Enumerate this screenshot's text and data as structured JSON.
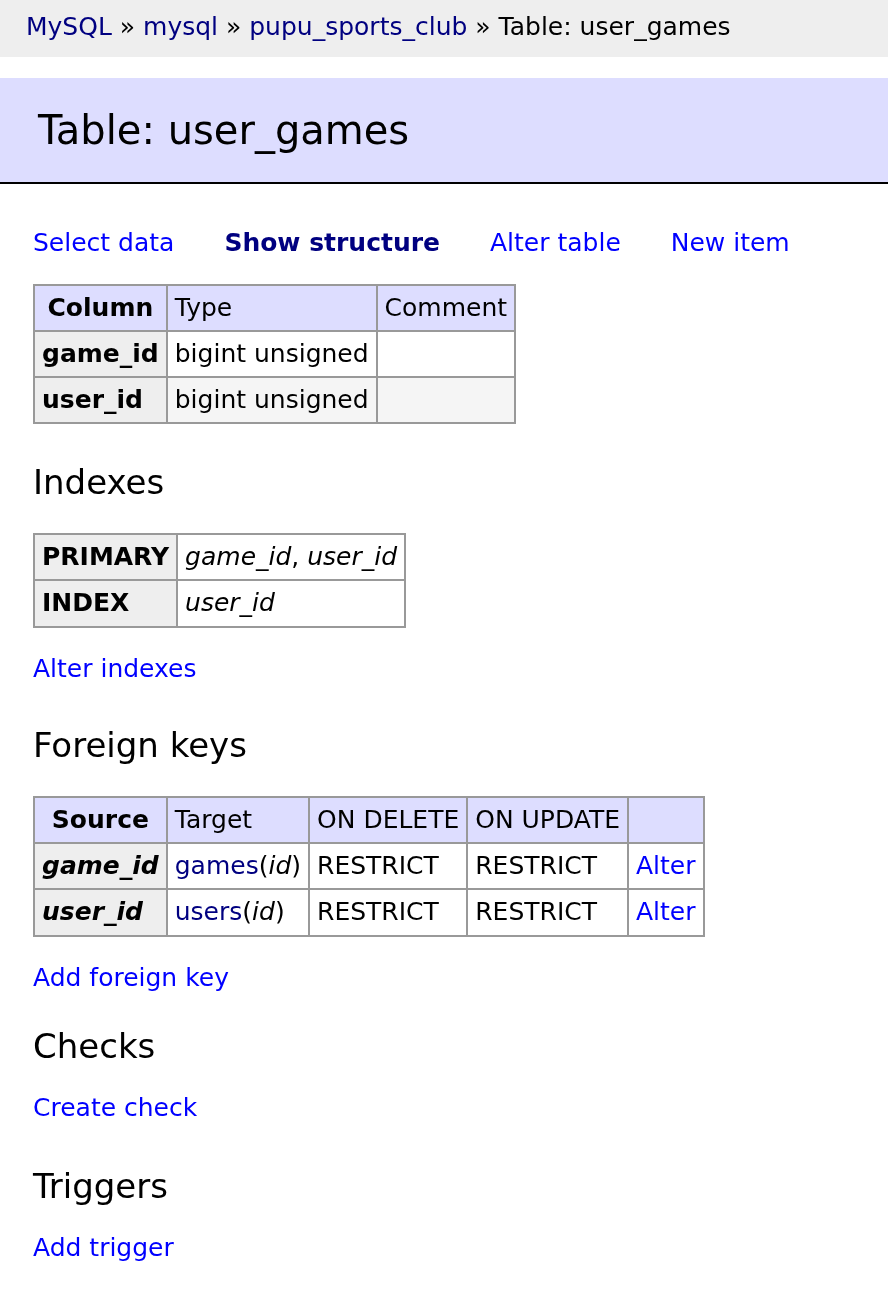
{
  "breadcrumb": {
    "links": [
      "MySQL",
      "mysql",
      "pupu_sports_club"
    ],
    "separator": "»",
    "current": "Table: user_games"
  },
  "title": "Table: user_games",
  "nav": [
    {
      "label": "Select data",
      "selected": false
    },
    {
      "label": "Show structure",
      "selected": true
    },
    {
      "label": "Alter table",
      "selected": false
    },
    {
      "label": "New item",
      "selected": false
    }
  ],
  "columns_table": {
    "headers": [
      "Column",
      "Type",
      "Comment"
    ],
    "rows": [
      {
        "column": "game_id",
        "type": "bigint unsigned"
      },
      {
        "column": "user_id",
        "type": "bigint unsigned"
      }
    ]
  },
  "indexes": {
    "heading": "Indexes",
    "rows": [
      {
        "type": "PRIMARY",
        "columns": "*game_id*, *user_id*"
      },
      {
        "type": "INDEX",
        "columns": "*user_id*"
      }
    ],
    "link": "Alter indexes"
  },
  "foreign_keys": {
    "heading": "Foreign keys",
    "headers": [
      "Source",
      "Target",
      "ON DELETE",
      "ON UPDATE"
    ],
    "rows": [
      {
        "source": "game_id",
        "target_table": "games",
        "target_column": "(*id*)",
        "on_delete": "RESTRICT",
        "on_update": "RESTRICT",
        "action": "Alter"
      },
      {
        "source": "user_id",
        "target_table": "users",
        "target_column": "(*id*)",
        "on_delete": "RESTRICT",
        "on_update": "RESTRICT",
        "action": "Alter"
      }
    ],
    "link": "Add foreign key"
  },
  "checks": {
    "heading": "Checks",
    "link": "Create check"
  },
  "triggers": {
    "heading": "Triggers",
    "link": "Add trigger"
  }
}
